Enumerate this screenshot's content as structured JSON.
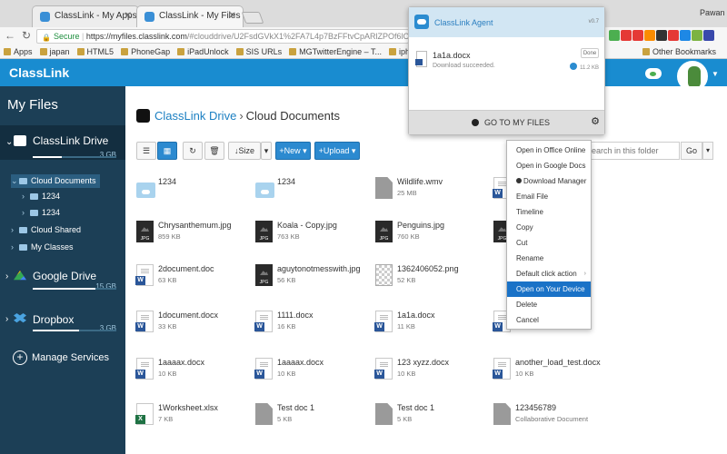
{
  "browser": {
    "tabs": [
      {
        "label": "ClassLink - My Apps",
        "active": false
      },
      {
        "label": "ClassLink - My Files",
        "active": true
      }
    ],
    "profile": "Pawan",
    "secure_label": "Secure",
    "url_host": "https://myfiles.classlink.com",
    "url_path": "/#clouddrive/U2FsdGVkX1%2FA7L4p7BzFFtvCpARlZPOf6lO6znqazVM%3D",
    "bookmarks": [
      "Apps",
      "japan",
      "HTML5",
      "PhoneGap",
      "iPadUnlock",
      "SIS URLs",
      "MGTwitterEngine – T...",
      "iphone - Multiple Pic...",
      "phpBB • Free"
    ],
    "other_bookmarks": "Other Bookmarks",
    "ext_colors": [
      "#4caf50",
      "#e53935",
      "#e53935",
      "#fb8c00",
      "#333333",
      "#e53935",
      "#1e88e5",
      "#7cb342",
      "#3949ab"
    ]
  },
  "app": {
    "logo": "ClassLink",
    "brand_color": "#198cd0"
  },
  "sidebar": {
    "title": "My Files",
    "drives": [
      {
        "name": "ClassLink Drive",
        "size": "3 GB",
        "used_fraction": 0.35
      },
      {
        "name": "Google Drive",
        "size": "15 GB",
        "used_fraction": 0.75
      },
      {
        "name": "Dropbox",
        "size": "3 GB",
        "used_fraction": 0.55
      }
    ],
    "tree": [
      "Cloud Documents",
      "1234",
      "1234",
      "Cloud Shared",
      "My Classes"
    ],
    "manage": "Manage Services"
  },
  "main": {
    "crumb_drive": "ClassLink Drive",
    "crumb_sep": "›",
    "crumb_folder": "Cloud Documents",
    "sort_label": "Size",
    "new_label": "New",
    "upload_label": "Upload",
    "search_placeholder": "Search in this folder",
    "go_label": "Go"
  },
  "files": [
    {
      "name": "1234",
      "meta": "",
      "type": "folder"
    },
    {
      "name": "1234",
      "meta": "",
      "type": "folder"
    },
    {
      "name": "Wildlife.wmv",
      "meta": "25 MB",
      "type": "generic"
    },
    {
      "name": "",
      "meta": "",
      "type": "doc"
    },
    {
      "name": "Chrysanthemum.jpg",
      "meta": "859 KB",
      "type": "jpg"
    },
    {
      "name": "Koala - Copy.jpg",
      "meta": "763 KB",
      "type": "jpg"
    },
    {
      "name": "Penguins.jpg",
      "meta": "760 KB",
      "type": "jpg"
    },
    {
      "name": "",
      "meta": "",
      "type": "jpg"
    },
    {
      "name": "2document.doc",
      "meta": "63 KB",
      "type": "doc"
    },
    {
      "name": "aguytonotmesswith.jpg",
      "meta": "56 KB",
      "type": "jpg"
    },
    {
      "name": "1362406052.png",
      "meta": "52 KB",
      "type": "png"
    },
    {
      "name": "",
      "meta": "",
      "type": "none"
    },
    {
      "name": "1document.docx",
      "meta": "33 KB",
      "type": "doc"
    },
    {
      "name": "1111.docx",
      "meta": "16 KB",
      "type": "doc"
    },
    {
      "name": "1a1a.docx",
      "meta": "11 KB",
      "type": "doc"
    },
    {
      "name": "",
      "meta": "",
      "type": "doc"
    },
    {
      "name": "1aaaax.docx",
      "meta": "10 KB",
      "type": "doc"
    },
    {
      "name": "1aaaax.docx",
      "meta": "10 KB",
      "type": "doc"
    },
    {
      "name": "123 xyzz.docx",
      "meta": "10 KB",
      "type": "doc"
    },
    {
      "name": "another_load_test.docx",
      "meta": "10 KB",
      "type": "doc"
    },
    {
      "name": "1Worksheet.xlsx",
      "meta": "7 KB",
      "type": "xls"
    },
    {
      "name": "Test doc 1",
      "meta": "5 KB",
      "type": "generic"
    },
    {
      "name": "Test doc 1",
      "meta": "5 KB",
      "type": "generic"
    },
    {
      "name": "123456789",
      "meta": "Collaborative Document",
      "type": "generic"
    }
  ],
  "agent": {
    "title": "ClassLink Agent",
    "version": "v0.7",
    "file": "1a1a.docx",
    "status": "Download succeeded.",
    "done": "Done",
    "size": "11.2 KB",
    "goto": "GO TO MY FILES"
  },
  "context_menu": [
    {
      "label": "Open in Office Online"
    },
    {
      "label": "Open in Google Docs"
    },
    {
      "label": "Download Manager",
      "dot": true
    },
    {
      "label": "Email File"
    },
    {
      "label": "Timeline"
    },
    {
      "label": "Copy"
    },
    {
      "label": "Cut"
    },
    {
      "label": "Rename"
    },
    {
      "label": "Default click action",
      "sub": "›"
    },
    {
      "label": "Open on Your Device",
      "highlighted": true
    },
    {
      "label": "Delete"
    },
    {
      "label": "Cancel"
    }
  ]
}
